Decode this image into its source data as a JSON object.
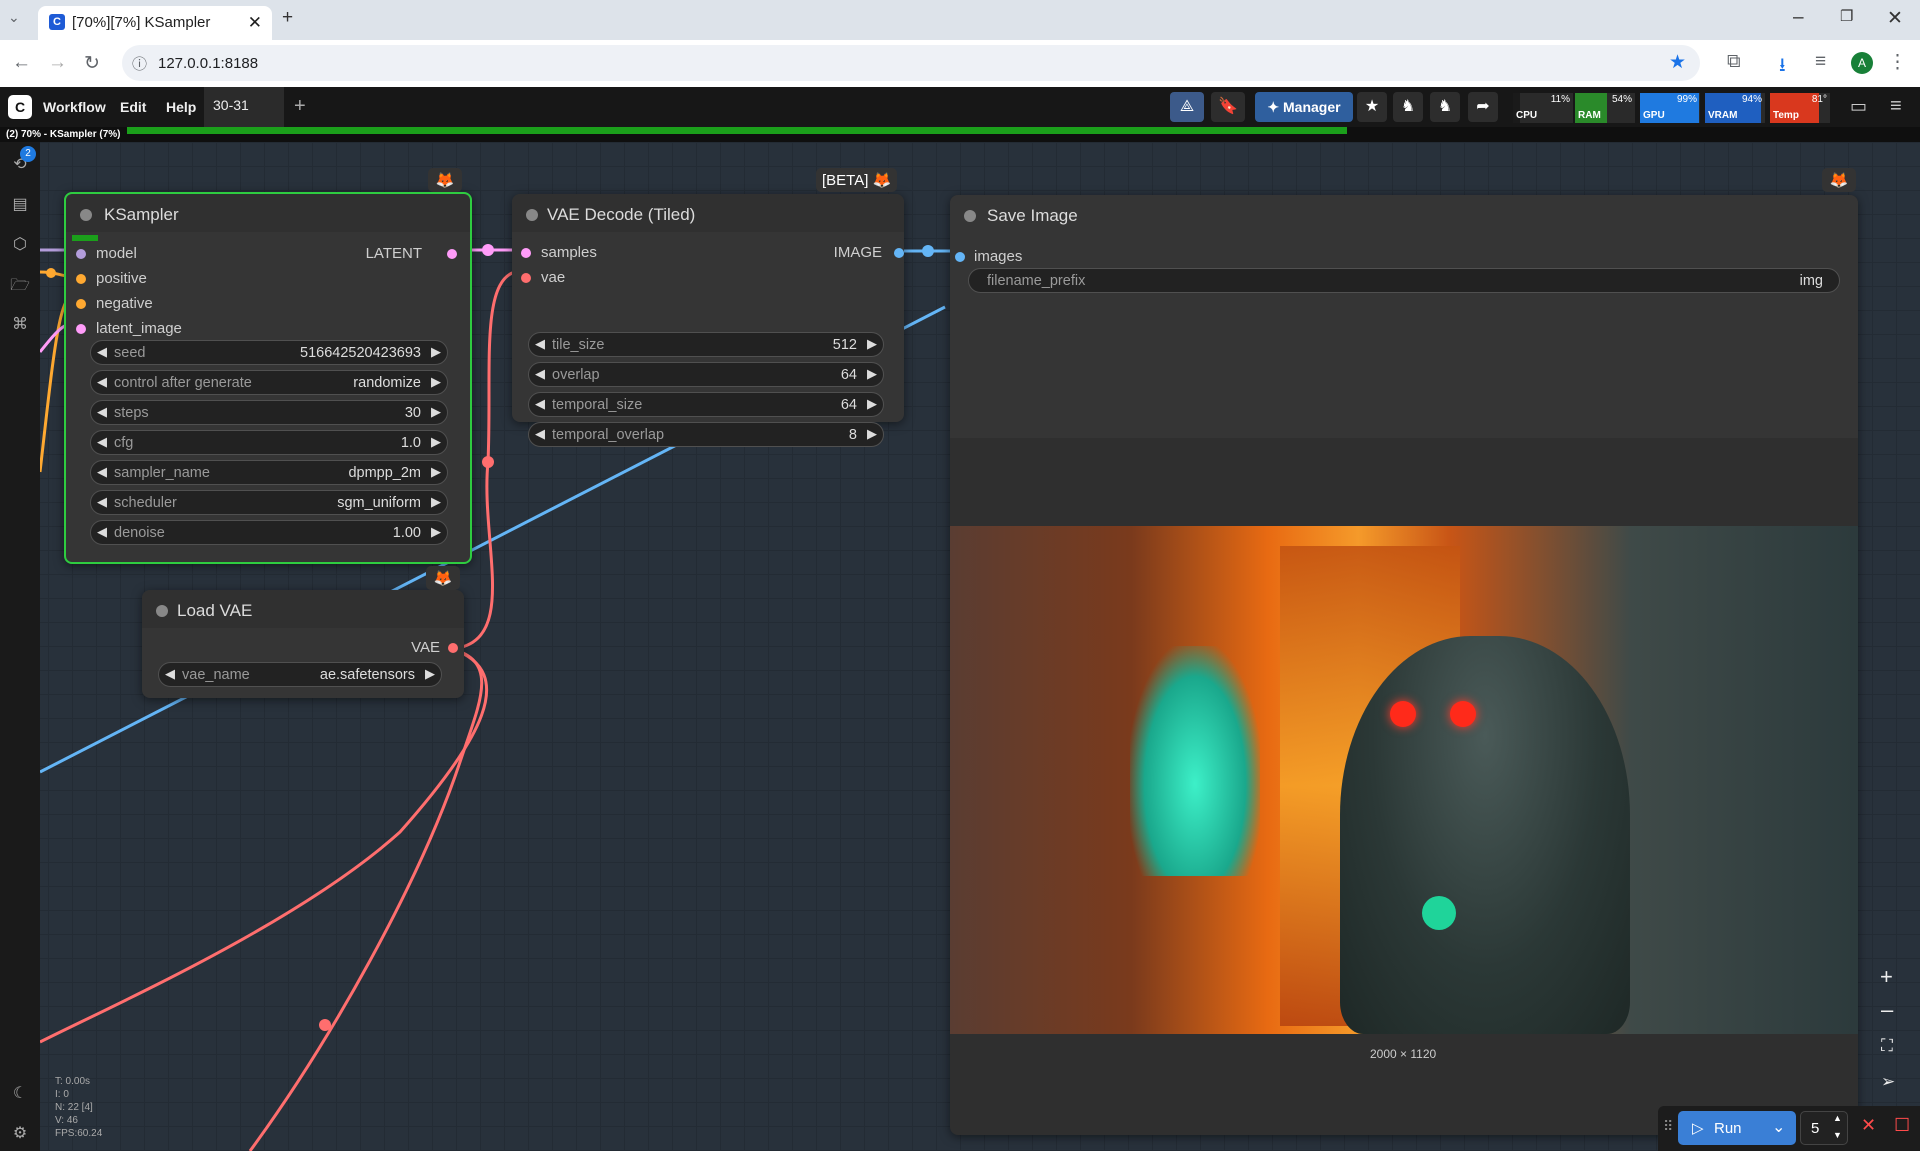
{
  "browser": {
    "tab_title": "[70%][7%] KSampler",
    "url": "127.0.0.1:8188",
    "profile_initial": "A"
  },
  "topbar": {
    "menus": [
      "Workflow",
      "Edit",
      "Help"
    ],
    "workflow_tab": "30-31",
    "manager_label": "Manager",
    "monitors": [
      {
        "label": "CPU",
        "value": "11%",
        "color": "#1a1a1a",
        "fill": 0.11
      },
      {
        "label": "RAM",
        "value": "54%",
        "color": "#2a8a2a",
        "fill": 0.54
      },
      {
        "label": "GPU",
        "value": "99%",
        "color": "#1f7ae0",
        "fill": 0.99
      },
      {
        "label": "VRAM",
        "value": "94%",
        "color": "#1f5fc0",
        "fill": 0.94
      },
      {
        "label": "Temp",
        "value": "81°",
        "color": "#d9381e",
        "fill": 0.81
      }
    ]
  },
  "progress": {
    "text": "(2) 70% - KSampler (7%)",
    "fraction": 0.7
  },
  "sidebar": {
    "queue_badge": "2"
  },
  "ksampler": {
    "title": "KSampler",
    "inputs": [
      "model",
      "positive",
      "negative",
      "latent_image"
    ],
    "output": "LATENT",
    "widgets": [
      {
        "label": "seed",
        "value": "516642520423693"
      },
      {
        "label": "control after generate",
        "value": "randomize"
      },
      {
        "label": "steps",
        "value": "30"
      },
      {
        "label": "cfg",
        "value": "1.0"
      },
      {
        "label": "sampler_name",
        "value": "dpmpp_2m"
      },
      {
        "label": "scheduler",
        "value": "sgm_uniform"
      },
      {
        "label": "denoise",
        "value": "1.00"
      }
    ]
  },
  "vae_decode": {
    "title": "VAE Decode (Tiled)",
    "badge": "[BETA]",
    "inputs": [
      "samples",
      "vae"
    ],
    "output": "IMAGE",
    "widgets": [
      {
        "label": "tile_size",
        "value": "512"
      },
      {
        "label": "overlap",
        "value": "64"
      },
      {
        "label": "temporal_size",
        "value": "64"
      },
      {
        "label": "temporal_overlap",
        "value": "8"
      }
    ]
  },
  "load_vae": {
    "title": "Load VAE",
    "output": "VAE",
    "widget": {
      "label": "vae_name",
      "value": "ae.safetensors"
    }
  },
  "save_image": {
    "title": "Save Image",
    "input": "images",
    "widget": {
      "label": "filename_prefix",
      "value": "img"
    },
    "image_size": "2000 × 1120"
  },
  "run": {
    "label": "Run",
    "count": "5"
  },
  "stats": [
    "T: 0.00s",
    "I: 0",
    "N: 22 [4]",
    "V: 46",
    "FPS:60.24"
  ]
}
